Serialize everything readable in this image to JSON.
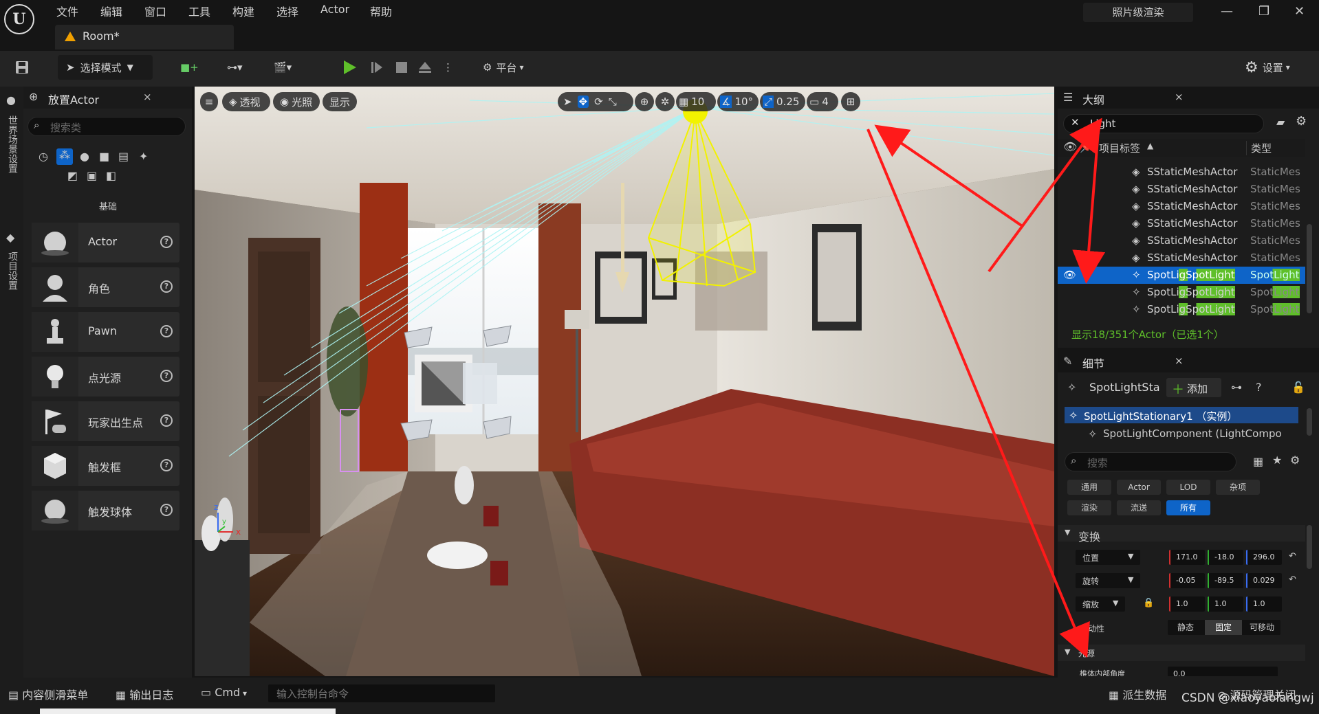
{
  "menubar": {
    "items": [
      "文件",
      "编辑",
      "窗口",
      "工具",
      "构建",
      "选择",
      "Actor",
      "帮助"
    ],
    "photoreal_label": "照片级渲染",
    "tab_label": "Room*"
  },
  "toolbar": {
    "select_mode": "选择模式",
    "platform": "平台",
    "settings": "设置"
  },
  "left_strip": {
    "world_settings": "世界场景设置",
    "project_settings": "项目设置"
  },
  "place_actors": {
    "title": "放置Actor",
    "search_placeholder": "搜索类",
    "category": "基础",
    "items": [
      {
        "label": "Actor",
        "icon": "sphere-icon"
      },
      {
        "label": "角色",
        "icon": "character-icon"
      },
      {
        "label": "Pawn",
        "icon": "pawn-icon"
      },
      {
        "label": "点光源",
        "icon": "point-light-icon"
      },
      {
        "label": "玩家出生点",
        "icon": "player-start-icon"
      },
      {
        "label": "触发框",
        "icon": "trigger-box-icon"
      },
      {
        "label": "触发球体",
        "icon": "trigger-sphere-icon"
      }
    ]
  },
  "viewport": {
    "perspective": "透视",
    "lighting": "光照",
    "show": "显示",
    "grid_snap": "10",
    "rotate_snap": "10°",
    "scale_snap": "0.25",
    "camera_speed": "4"
  },
  "outliner": {
    "title": "大纲",
    "search_value": "Light",
    "col_label": "项目标签",
    "col_type": "类型",
    "rows": [
      {
        "name": "SStaticMeshActor",
        "type": "StaticMes"
      },
      {
        "name": "SStaticMeshActor",
        "type": "StaticMes"
      },
      {
        "name": "SStaticMeshActor",
        "type": "StaticMes"
      },
      {
        "name": "SStaticMeshActor",
        "type": "StaticMes"
      },
      {
        "name": "SStaticMeshActor",
        "type": "StaticMes"
      },
      {
        "name": "SStaticMeshActor",
        "type": "StaticMes"
      },
      {
        "name": "SpotLigSpotLight",
        "type": "SpotLight"
      },
      {
        "name": "SpotLigSpotLight",
        "type": "SpotLight"
      },
      {
        "name": "SpotLigSpotLight",
        "type": "SpotLight"
      }
    ],
    "status": "显示18/351个Actor（已选1个）"
  },
  "details": {
    "title": "细节",
    "actor_name": "SpotLightSta",
    "add_label": "添加",
    "instance": "SpotLightStationary1 （实例）",
    "component": "SpotLightComponent (LightCompo",
    "search_placeholder": "搜索",
    "categories": [
      "通用",
      "Actor",
      "LOD",
      "杂项",
      "渲染",
      "流送",
      "所有"
    ],
    "transform_section": "变换",
    "location_label": "位置",
    "location": [
      "171.0",
      "-18.0",
      "296.0"
    ],
    "rotation_label": "旋转",
    "rotation": [
      "-0.05",
      "-89.5",
      "0.029"
    ],
    "scale_label": "缩放",
    "scale": [
      "1.0",
      "1.0",
      "1.0"
    ],
    "mobility_label": "移动性",
    "mobility": [
      "静态",
      "固定",
      "可移动"
    ],
    "light_section": "光源",
    "inner_cone_label": "椎体内部角度",
    "inner_cone_value": "0.0"
  },
  "bottombar": {
    "content_drawer": "内容侧滑菜单",
    "output_log": "输出日志",
    "cmd": "Cmd",
    "console_placeholder": "输入控制台命令",
    "derived_data": "派生数据",
    "source_control": "源码管理关闭",
    "watermark": "CSDN @xiaoyaolangwj"
  },
  "colors": {
    "accent_blue": "#0e64c8",
    "highlight_green": "#5fbf2a",
    "status_green": "#5fbf2a",
    "annotation_red": "#ff1a1a"
  }
}
